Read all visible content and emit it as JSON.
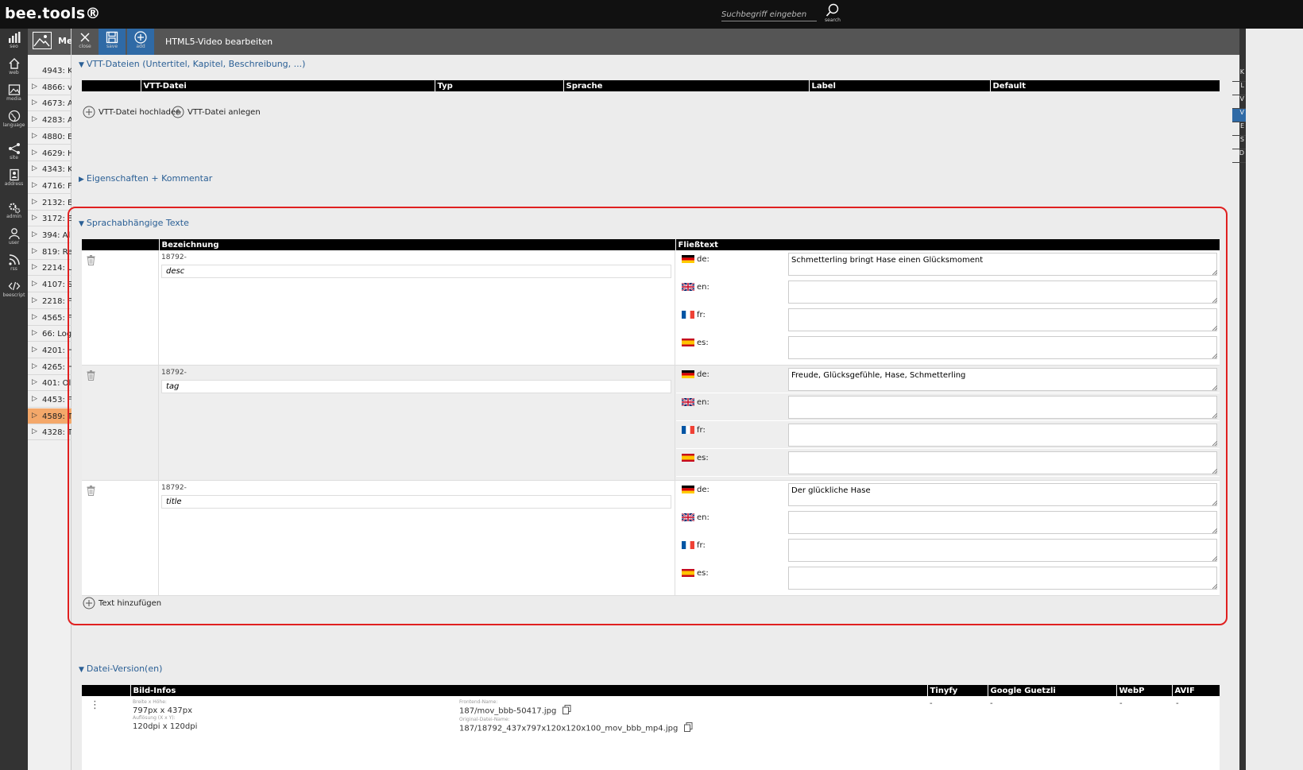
{
  "app": {
    "logo": "bee.tools®"
  },
  "search": {
    "placeholder": "Suchbegriff eingeben",
    "label": "search"
  },
  "rail": [
    {
      "label": "seo",
      "icon": "chart-icon"
    },
    {
      "label": "web",
      "icon": "home-icon"
    },
    {
      "label": "media",
      "icon": "image-icon"
    },
    {
      "label": "language",
      "icon": "globe-icon"
    },
    {
      "label": "site",
      "icon": "sitemap-icon"
    },
    {
      "label": "address",
      "icon": "address-book-icon"
    },
    {
      "label": "admin",
      "icon": "gears-icon"
    },
    {
      "label": "user",
      "icon": "user-icon"
    },
    {
      "label": "rss",
      "icon": "rss-icon"
    },
    {
      "label": "beescript",
      "icon": "code-icon"
    }
  ],
  "tree": {
    "head_label": "Me",
    "items": [
      {
        "text": "4943: K",
        "active": false
      },
      {
        "text": "4866: v",
        "active": false
      },
      {
        "text": "4673: A",
        "active": false
      },
      {
        "text": "4283: A",
        "active": false
      },
      {
        "text": "4880: E",
        "active": false
      },
      {
        "text": "4629: H",
        "active": false
      },
      {
        "text": "4343: K",
        "active": false
      },
      {
        "text": "4716: F",
        "active": false
      },
      {
        "text": "2132: E",
        "active": false
      },
      {
        "text": "3172: E",
        "active": false
      },
      {
        "text": "394: Al",
        "active": false
      },
      {
        "text": "819: Re",
        "active": false
      },
      {
        "text": "2214: U",
        "active": false
      },
      {
        "text": "4107: S",
        "active": false
      },
      {
        "text": "2218: F",
        "active": false
      },
      {
        "text": "4565: F",
        "active": false
      },
      {
        "text": "66: Log",
        "active": false
      },
      {
        "text": "4201: H",
        "active": false
      },
      {
        "text": "4265: H",
        "active": false
      },
      {
        "text": "401: Ol",
        "active": false
      },
      {
        "text": "4453: F",
        "active": false
      },
      {
        "text": "4589: T",
        "active": true
      },
      {
        "text": "4328: T",
        "active": false
      }
    ]
  },
  "toolbar": {
    "close_label": "close",
    "save_label": "save",
    "add_label": "add",
    "title": "HTML5-Video bearbeiten"
  },
  "right_rail": [
    {
      "text": "K",
      "active": false
    },
    {
      "text": "L",
      "active": false
    },
    {
      "text": "V",
      "active": false
    },
    {
      "text": "V",
      "active": true
    },
    {
      "text": "E",
      "active": false
    },
    {
      "text": "S",
      "active": false
    },
    {
      "text": "D",
      "active": false
    }
  ],
  "vtt": {
    "title": "VTT-Dateien (Untertitel, Kapitel, Beschreibung, ...)",
    "columns": [
      "VTT-Datei",
      "Typ",
      "Sprache",
      "Label",
      "Default"
    ],
    "upload_label": "VTT-Datei hochladen",
    "create_label": "VTT-Datei anlegen"
  },
  "properties": {
    "title": "Eigenschaften + Kommentar"
  },
  "texts": {
    "title": "Sprachabhängige Texte",
    "col_name": "Bezeichnung",
    "col_text": "Fließtext",
    "add_label": "Text hinzufügen",
    "rows": [
      {
        "id": "18792-",
        "name": "desc",
        "langs": [
          {
            "code": "de:",
            "flag": "de",
            "value": "Schmetterling bringt Hase einen Glücksmoment"
          },
          {
            "code": "en:",
            "flag": "en",
            "value": ""
          },
          {
            "code": "fr:",
            "flag": "fr",
            "value": ""
          },
          {
            "code": "es:",
            "flag": "es",
            "value": ""
          }
        ]
      },
      {
        "id": "18792-",
        "name": "tag",
        "langs": [
          {
            "code": "de:",
            "flag": "de",
            "value": "Freude, Glücksgefühle, Hase, Schmetterling"
          },
          {
            "code": "en:",
            "flag": "en",
            "value": ""
          },
          {
            "code": "fr:",
            "flag": "fr",
            "value": ""
          },
          {
            "code": "es:",
            "flag": "es",
            "value": ""
          }
        ]
      },
      {
        "id": "18792-",
        "name": "title",
        "langs": [
          {
            "code": "de:",
            "flag": "de",
            "value": "Der glückliche Hase"
          },
          {
            "code": "en:",
            "flag": "en",
            "value": ""
          },
          {
            "code": "fr:",
            "flag": "fr",
            "value": ""
          },
          {
            "code": "es:",
            "flag": "es",
            "value": ""
          }
        ]
      }
    ]
  },
  "versions": {
    "title": "Datei-Version(en)",
    "columns": [
      "Bild-Infos",
      "Tinyfy",
      "Google Guetzli",
      "WebP",
      "AVIF"
    ],
    "row": {
      "size_label": "Breite x Höhe:",
      "size_value": "797px x 437px",
      "res_label": "Auflösung (X x Y):",
      "res_value": "120dpi x 120dpi",
      "frontend_label": "Frontend-Name:",
      "frontend_value": "187/mov_bbb-50417.jpg",
      "original_label": "Original-Datei-Name:",
      "original_value": "187/18792_437x797x120x120x100_mov_bbb_mp4.jpg",
      "tinyfy": "-",
      "guetzli": "-",
      "webp": "-",
      "avif": "-"
    }
  },
  "colors": {
    "accent": "#2f6aa6",
    "highlight_border": "#e02020",
    "active_tree": "#f4a86a"
  }
}
